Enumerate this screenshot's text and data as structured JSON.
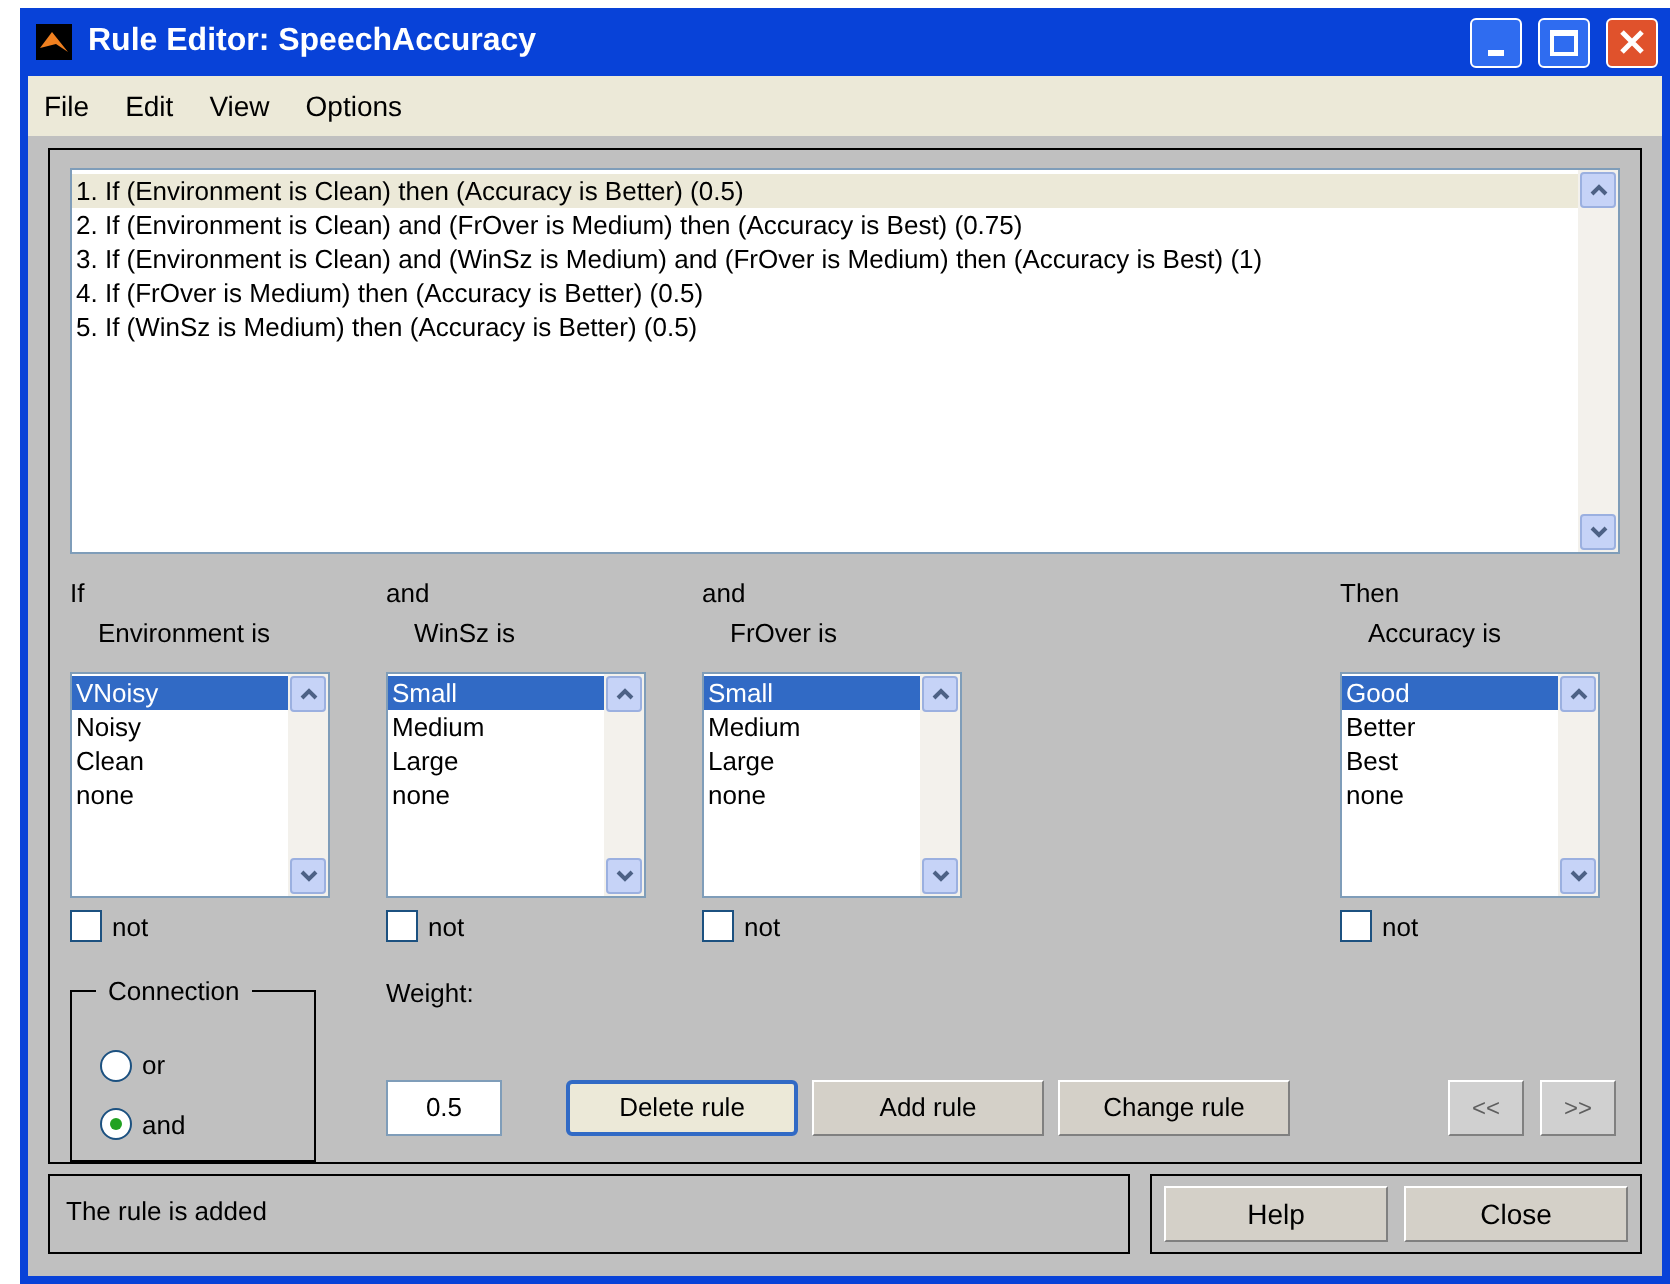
{
  "window": {
    "title": "Rule Editor: SpeechAccuracy"
  },
  "menu": [
    "File",
    "Edit",
    "View",
    "Options"
  ],
  "rules": [
    {
      "text": "1. If (Environment is Clean) then (Accuracy is Better) (0.5)",
      "selected": true
    },
    {
      "text": "2. If (Environment is Clean) and (FrOver is Medium) then (Accuracy is Best) (0.75)",
      "selected": false
    },
    {
      "text": "3. If (Environment is Clean) and (WinSz is Medium) and (FrOver is Medium) then (Accuracy is Best) (1)",
      "selected": false
    },
    {
      "text": "4. If (FrOver is Medium) then (Accuracy is Better) (0.5)",
      "selected": false
    },
    {
      "text": "5. If (WinSz is Medium) then (Accuracy is Better) (0.5)",
      "selected": false
    }
  ],
  "variables": [
    {
      "connector": "If",
      "label": "Environment is",
      "not_label": "not",
      "not": false,
      "items": [
        {
          "text": "VNoisy",
          "selected": true
        },
        {
          "text": "Noisy",
          "selected": false
        },
        {
          "text": "Clean",
          "selected": false
        },
        {
          "text": "none",
          "selected": false
        }
      ]
    },
    {
      "connector": "and",
      "label": "WinSz is",
      "not_label": "not",
      "not": false,
      "items": [
        {
          "text": "Small",
          "selected": true
        },
        {
          "text": "Medium",
          "selected": false
        },
        {
          "text": "Large",
          "selected": false
        },
        {
          "text": "none",
          "selected": false
        }
      ]
    },
    {
      "connector": "and",
      "label": "FrOver is",
      "not_label": "not",
      "not": false,
      "items": [
        {
          "text": "Small",
          "selected": true
        },
        {
          "text": "Medium",
          "selected": false
        },
        {
          "text": "Large",
          "selected": false
        },
        {
          "text": "none",
          "selected": false
        }
      ]
    },
    {
      "connector": "Then",
      "label": "Accuracy is",
      "not_label": "not",
      "not": false,
      "items": [
        {
          "text": "Good",
          "selected": true
        },
        {
          "text": "Better",
          "selected": false
        },
        {
          "text": "Best",
          "selected": false
        },
        {
          "text": "none",
          "selected": false
        }
      ]
    }
  ],
  "connection": {
    "title": "Connection",
    "options": [
      {
        "label": "or",
        "selected": false
      },
      {
        "label": "and",
        "selected": true
      }
    ]
  },
  "weight": {
    "label": "Weight:",
    "value": "0.5"
  },
  "buttons": [
    {
      "label": "Delete rule",
      "focused": true
    },
    {
      "label": "Add rule",
      "focused": false
    },
    {
      "label": "Change rule",
      "focused": false
    }
  ],
  "nav": [
    {
      "label": "<<",
      "disabled": true
    },
    {
      "label": ">>",
      "disabled": true
    }
  ],
  "status": "The rule is added",
  "footer_buttons": [
    "Help",
    "Close"
  ]
}
